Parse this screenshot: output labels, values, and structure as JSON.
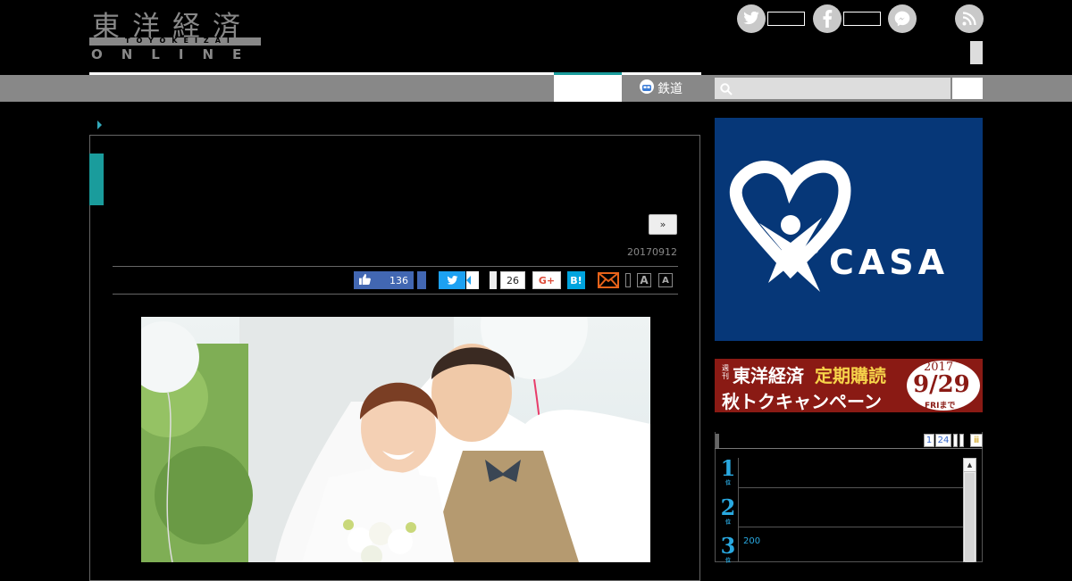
{
  "logo": {
    "kanji": "東洋経済",
    "romaji": "TOYOKEIZAI",
    "online": "ONLINE"
  },
  "header": {
    "social_icons": [
      "twitter-icon",
      "facebook-icon",
      "messenger-icon",
      "rss-icon"
    ]
  },
  "nav": {
    "rail_label": "鉄道",
    "search_placeholder": ""
  },
  "article": {
    "next_label": "»",
    "date": "20170912",
    "share": {
      "like_count": "136",
      "pocket_count": "26",
      "gplus_label": "G+",
      "hatena_label": "B!",
      "font_size_large": "A",
      "font_size_small": "A"
    },
    "photo_alt": "wedding couple with balloons"
  },
  "sidebar": {
    "ad_casa_text": "CASA",
    "ad_sub": {
      "weekly": "週刊",
      "brand": "東洋経済",
      "title": "定期購読",
      "campaign": "秋トクキャンペーン",
      "year": "2017",
      "date": "9/29",
      "until": "FRIまで"
    },
    "ranking": {
      "tabs": [
        "1",
        "24"
      ],
      "items": [
        {
          "rank": "1",
          "suffix": "位",
          "text": ""
        },
        {
          "rank": "2",
          "suffix": "位",
          "text": ""
        },
        {
          "rank": "3",
          "suffix": "位",
          "text": "200"
        }
      ]
    }
  },
  "colors": {
    "accent": "#1a9c9c",
    "nav_bg": "#888888",
    "casa_bg": "#063778",
    "facebook": "#4267b2",
    "twitter": "#1da1f2"
  }
}
